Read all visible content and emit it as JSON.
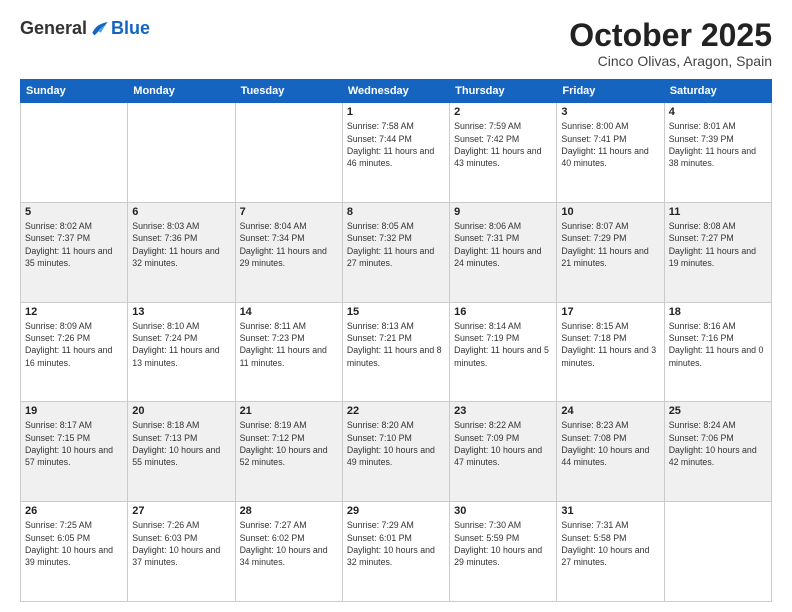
{
  "header": {
    "logo_general": "General",
    "logo_blue": "Blue",
    "month_title": "October 2025",
    "subtitle": "Cinco Olivas, Aragon, Spain"
  },
  "days_of_week": [
    "Sunday",
    "Monday",
    "Tuesday",
    "Wednesday",
    "Thursday",
    "Friday",
    "Saturday"
  ],
  "weeks": [
    [
      {
        "day": "",
        "info": ""
      },
      {
        "day": "",
        "info": ""
      },
      {
        "day": "",
        "info": ""
      },
      {
        "day": "1",
        "info": "Sunrise: 7:58 AM\nSunset: 7:44 PM\nDaylight: 11 hours and 46 minutes."
      },
      {
        "day": "2",
        "info": "Sunrise: 7:59 AM\nSunset: 7:42 PM\nDaylight: 11 hours and 43 minutes."
      },
      {
        "day": "3",
        "info": "Sunrise: 8:00 AM\nSunset: 7:41 PM\nDaylight: 11 hours and 40 minutes."
      },
      {
        "day": "4",
        "info": "Sunrise: 8:01 AM\nSunset: 7:39 PM\nDaylight: 11 hours and 38 minutes."
      }
    ],
    [
      {
        "day": "5",
        "info": "Sunrise: 8:02 AM\nSunset: 7:37 PM\nDaylight: 11 hours and 35 minutes."
      },
      {
        "day": "6",
        "info": "Sunrise: 8:03 AM\nSunset: 7:36 PM\nDaylight: 11 hours and 32 minutes."
      },
      {
        "day": "7",
        "info": "Sunrise: 8:04 AM\nSunset: 7:34 PM\nDaylight: 11 hours and 29 minutes."
      },
      {
        "day": "8",
        "info": "Sunrise: 8:05 AM\nSunset: 7:32 PM\nDaylight: 11 hours and 27 minutes."
      },
      {
        "day": "9",
        "info": "Sunrise: 8:06 AM\nSunset: 7:31 PM\nDaylight: 11 hours and 24 minutes."
      },
      {
        "day": "10",
        "info": "Sunrise: 8:07 AM\nSunset: 7:29 PM\nDaylight: 11 hours and 21 minutes."
      },
      {
        "day": "11",
        "info": "Sunrise: 8:08 AM\nSunset: 7:27 PM\nDaylight: 11 hours and 19 minutes."
      }
    ],
    [
      {
        "day": "12",
        "info": "Sunrise: 8:09 AM\nSunset: 7:26 PM\nDaylight: 11 hours and 16 minutes."
      },
      {
        "day": "13",
        "info": "Sunrise: 8:10 AM\nSunset: 7:24 PM\nDaylight: 11 hours and 13 minutes."
      },
      {
        "day": "14",
        "info": "Sunrise: 8:11 AM\nSunset: 7:23 PM\nDaylight: 11 hours and 11 minutes."
      },
      {
        "day": "15",
        "info": "Sunrise: 8:13 AM\nSunset: 7:21 PM\nDaylight: 11 hours and 8 minutes."
      },
      {
        "day": "16",
        "info": "Sunrise: 8:14 AM\nSunset: 7:19 PM\nDaylight: 11 hours and 5 minutes."
      },
      {
        "day": "17",
        "info": "Sunrise: 8:15 AM\nSunset: 7:18 PM\nDaylight: 11 hours and 3 minutes."
      },
      {
        "day": "18",
        "info": "Sunrise: 8:16 AM\nSunset: 7:16 PM\nDaylight: 11 hours and 0 minutes."
      }
    ],
    [
      {
        "day": "19",
        "info": "Sunrise: 8:17 AM\nSunset: 7:15 PM\nDaylight: 10 hours and 57 minutes."
      },
      {
        "day": "20",
        "info": "Sunrise: 8:18 AM\nSunset: 7:13 PM\nDaylight: 10 hours and 55 minutes."
      },
      {
        "day": "21",
        "info": "Sunrise: 8:19 AM\nSunset: 7:12 PM\nDaylight: 10 hours and 52 minutes."
      },
      {
        "day": "22",
        "info": "Sunrise: 8:20 AM\nSunset: 7:10 PM\nDaylight: 10 hours and 49 minutes."
      },
      {
        "day": "23",
        "info": "Sunrise: 8:22 AM\nSunset: 7:09 PM\nDaylight: 10 hours and 47 minutes."
      },
      {
        "day": "24",
        "info": "Sunrise: 8:23 AM\nSunset: 7:08 PM\nDaylight: 10 hours and 44 minutes."
      },
      {
        "day": "25",
        "info": "Sunrise: 8:24 AM\nSunset: 7:06 PM\nDaylight: 10 hours and 42 minutes."
      }
    ],
    [
      {
        "day": "26",
        "info": "Sunrise: 7:25 AM\nSunset: 6:05 PM\nDaylight: 10 hours and 39 minutes."
      },
      {
        "day": "27",
        "info": "Sunrise: 7:26 AM\nSunset: 6:03 PM\nDaylight: 10 hours and 37 minutes."
      },
      {
        "day": "28",
        "info": "Sunrise: 7:27 AM\nSunset: 6:02 PM\nDaylight: 10 hours and 34 minutes."
      },
      {
        "day": "29",
        "info": "Sunrise: 7:29 AM\nSunset: 6:01 PM\nDaylight: 10 hours and 32 minutes."
      },
      {
        "day": "30",
        "info": "Sunrise: 7:30 AM\nSunset: 5:59 PM\nDaylight: 10 hours and 29 minutes."
      },
      {
        "day": "31",
        "info": "Sunrise: 7:31 AM\nSunset: 5:58 PM\nDaylight: 10 hours and 27 minutes."
      },
      {
        "day": "",
        "info": ""
      }
    ]
  ]
}
